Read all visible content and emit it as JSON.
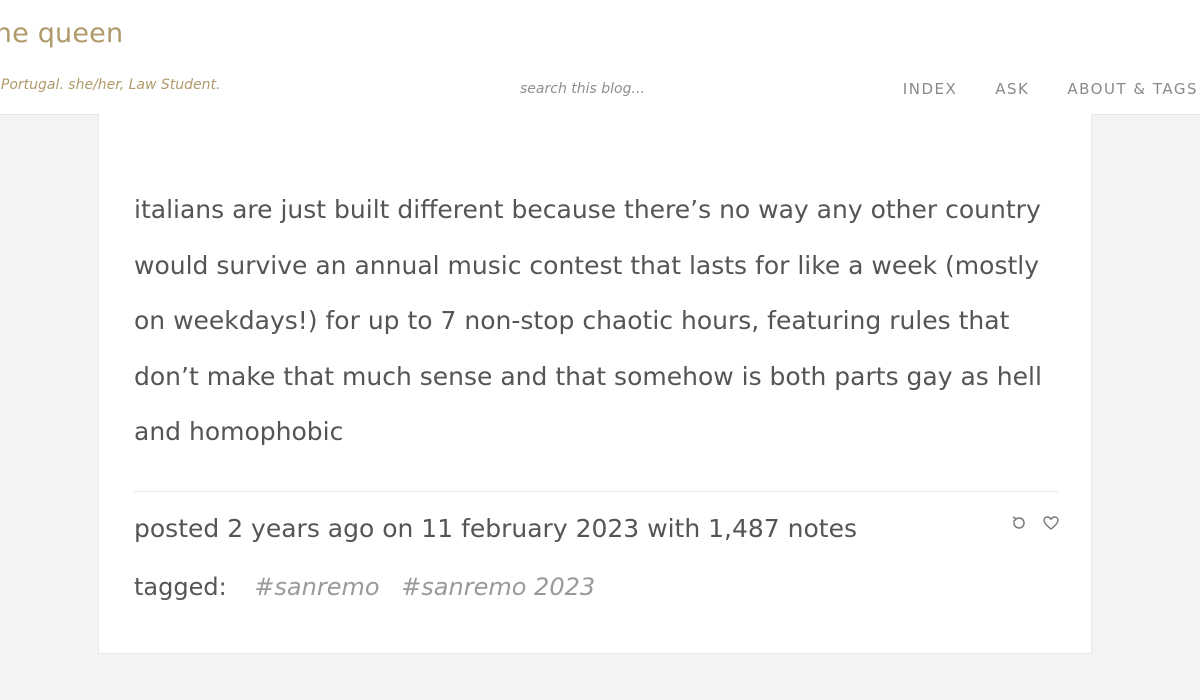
{
  "header": {
    "title": "ene queen",
    "description": ", Portugal. she/her, Law Student.",
    "search_placeholder": "search this blog...",
    "nav": [
      "INDEX",
      "ASK",
      "ABOUT & TAGS"
    ]
  },
  "post": {
    "body": "italians are just built different because there’s no way any other country would survive an annual music contest that lasts for like a week (mostly on weekdays!) for up to 7 non-stop chaotic hours, featuring rules that don’t make that much sense and that somehow is both parts gay as hell and homophobic",
    "meta": "posted 2 years ago on 11 february 2023 with 1,487 notes",
    "tagged_label": "tagged:",
    "tags": [
      "#sanremo",
      "#sanremo 2023"
    ]
  },
  "icons": {
    "reblog": "reblog-icon",
    "like": "heart-icon"
  },
  "colors": {
    "accent": "#b09a6a",
    "text": "#555555",
    "muted": "#9a9a9a",
    "background": "#f3f3f3"
  }
}
